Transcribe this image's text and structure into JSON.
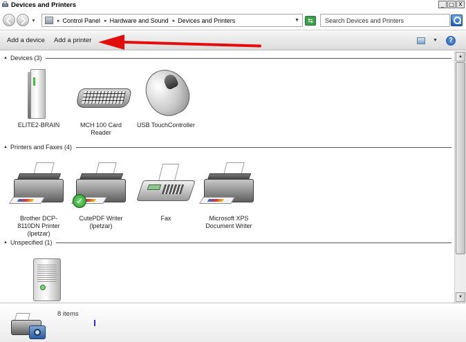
{
  "window": {
    "title": "Devices and Printers",
    "buttons": {
      "minimize": "_",
      "maximize": "□",
      "close": "X"
    }
  },
  "address": {
    "breadcrumbs": [
      "Control Panel",
      "Hardware and Sound",
      "Devices and Printers"
    ],
    "search_placeholder": "Search Devices and Printers"
  },
  "commands": {
    "add_device": "Add a device",
    "add_printer": "Add a printer",
    "help": "?"
  },
  "annotation": {
    "arrow_color": "#e40d0d"
  },
  "groups": [
    {
      "label": "Devices (3)",
      "items": [
        {
          "name": "ELITE2-BRAIN",
          "icon": "computer-tower-icon"
        },
        {
          "name": "MCH 100 Card Reader",
          "icon": "keyboard-card-reader-icon"
        },
        {
          "name": "USB TouchController",
          "icon": "mouse-icon"
        }
      ]
    },
    {
      "label": "Printers and Faxes (4)",
      "items": [
        {
          "name": "Brother DCP-8110DN Printer (lpetzar)",
          "icon": "printer-icon"
        },
        {
          "name": "CutePDF Writer (lpetzar)",
          "icon": "printer-default-icon",
          "default": true
        },
        {
          "name": "Fax",
          "icon": "fax-icon"
        },
        {
          "name": "Microsoft XPS Document Writer",
          "icon": "printer-icon"
        }
      ]
    },
    {
      "label": "Unspecified (1)",
      "items": [
        {
          "name": "",
          "icon": "unspecified-device-icon"
        }
      ]
    }
  ],
  "details": {
    "count": "8 items"
  }
}
